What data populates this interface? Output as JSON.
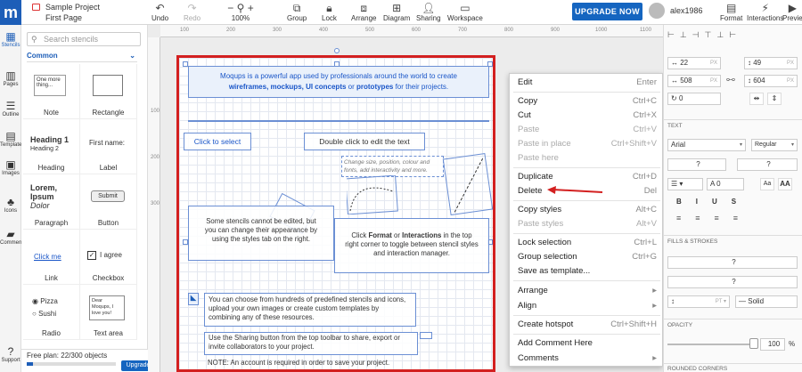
{
  "project": {
    "name": "Sample Project",
    "page": "First Page"
  },
  "toolbar": {
    "undo": "Undo",
    "redo": "Redo",
    "zoom": "100%",
    "group": "Group",
    "lock": "Lock",
    "arrange": "Arrange",
    "diagram": "Diagram",
    "sharing": "Sharing",
    "workspace": "Workspace",
    "upgrade": "UPGRADE NOW",
    "user": "alex1986",
    "format": "Format",
    "interactions": "Interactions",
    "preview": "Previe"
  },
  "leftnav": [
    "Stencils",
    "Pages",
    "Outline",
    "Templates",
    "Images",
    "Icons",
    "Comments",
    "Support"
  ],
  "stencils": {
    "search_placeholder": "Search stencils",
    "category": "Common",
    "items": [
      {
        "label": "Note",
        "preview": "One more thing..."
      },
      {
        "label": "Rectangle",
        "preview": ""
      },
      {
        "label": "Heading",
        "preview": "Heading 1",
        "preview2": "Heading 2"
      },
      {
        "label": "Label",
        "preview": "First name:"
      },
      {
        "label": "Paragraph",
        "preview": "Lorem, Ipsum",
        "preview2": "Dolor"
      },
      {
        "label": "Button",
        "preview": "Submit"
      },
      {
        "label": "Link",
        "preview": "Click me"
      },
      {
        "label": "Checkbox",
        "preview": "I agree"
      },
      {
        "label": "Radio",
        "preview": "Pizza",
        "preview2": "Sushi"
      },
      {
        "label": "Text area",
        "preview": "Dear Moqups, I love you!"
      }
    ]
  },
  "freeplan": {
    "text": "Free plan: 22/300 objects",
    "used": 22,
    "total": 300,
    "button": "Upgrade"
  },
  "ruler": {
    "h": [
      "100",
      "200",
      "300",
      "400",
      "500",
      "600",
      "700",
      "800",
      "900",
      "1000",
      "1100"
    ],
    "v": [
      "100",
      "200",
      "300"
    ]
  },
  "canvas": {
    "intro_line1": "Moqups is a powerful app used by professionals around the world to create",
    "intro_line2_a": "wireframes, mockups, UI concepts",
    "intro_line2_b": " or ",
    "intro_line2_c": "prototypes",
    "intro_line2_d": " for their projects.",
    "click_select": "Click to select",
    "double_click": "Double click to edit the text",
    "change_size": "Change size, position, colour and fonts, add interactivity and more.",
    "stencils_note": "Some stencils cannot be edited, but you can change their appearance by using the styles tab on the right.",
    "format_note_a": "Click ",
    "format_note_b": "Format",
    "format_note_c": " or ",
    "format_note_d": "Interactions",
    "format_note_e": " in the top right corner to toggle between stencil styles and interaction manager.",
    "choose_note": "You can choose from hundreds of predefined stencils and icons, upload your own images or create custom templates by combining any of these resources.",
    "sharing_note": "Use the Sharing button from the top toolbar to share, export or invite collaborators to your project.",
    "note_line": "NOTE: An account is required in order to save your project."
  },
  "context_menu": [
    {
      "label": "Edit",
      "shortcut": "Enter",
      "disabled": false
    },
    {
      "label": "Copy",
      "shortcut": "Ctrl+C",
      "disabled": false
    },
    {
      "label": "Cut",
      "shortcut": "Ctrl+X",
      "disabled": false
    },
    {
      "label": "Paste",
      "shortcut": "Ctrl+V",
      "disabled": true
    },
    {
      "label": "Paste in place",
      "shortcut": "Ctrl+Shift+V",
      "disabled": true
    },
    {
      "label": "Paste here",
      "shortcut": "",
      "disabled": true
    },
    {
      "label": "Duplicate",
      "shortcut": "Ctrl+D",
      "disabled": false
    },
    {
      "label": "Delete",
      "shortcut": "Del",
      "disabled": false
    },
    {
      "label": "Copy styles",
      "shortcut": "Alt+C",
      "disabled": false
    },
    {
      "label": "Paste styles",
      "shortcut": "Alt+V",
      "disabled": true
    },
    {
      "label": "Lock selection",
      "shortcut": "Ctrl+L",
      "disabled": false
    },
    {
      "label": "Group selection",
      "shortcut": "Ctrl+G",
      "disabled": false
    },
    {
      "label": "Save as template...",
      "shortcut": "",
      "disabled": false
    },
    {
      "label": "Arrange",
      "shortcut": "▸",
      "disabled": false
    },
    {
      "label": "Align",
      "shortcut": "▸",
      "disabled": false
    },
    {
      "label": "Create hotspot",
      "shortcut": "Ctrl+Shift+H",
      "disabled": false
    },
    {
      "label": "Add Comment Here",
      "shortcut": "",
      "disabled": false
    },
    {
      "label": "Comments",
      "shortcut": "▸",
      "disabled": false
    }
  ],
  "rightpanel": {
    "x": "22",
    "y": "49",
    "w": "508",
    "h": "604",
    "rot": "0",
    "unit": "PX",
    "text_section": "TEXT",
    "font": "Arial",
    "weight": "Regular",
    "size": "?",
    "line": "?",
    "spacing": "0",
    "fills_section": "FILLS & STROKES",
    "fill": "?",
    "stroke": "?",
    "stroke_style": "Solid",
    "opacity_section": "OPACITY",
    "opacity": "100",
    "opacity_unit": "%",
    "corners_section": "ROUNDED CORNERS"
  },
  "colors": {
    "brand": "#1565c0",
    "selection": "#d32020",
    "arrow": "#d32020"
  }
}
